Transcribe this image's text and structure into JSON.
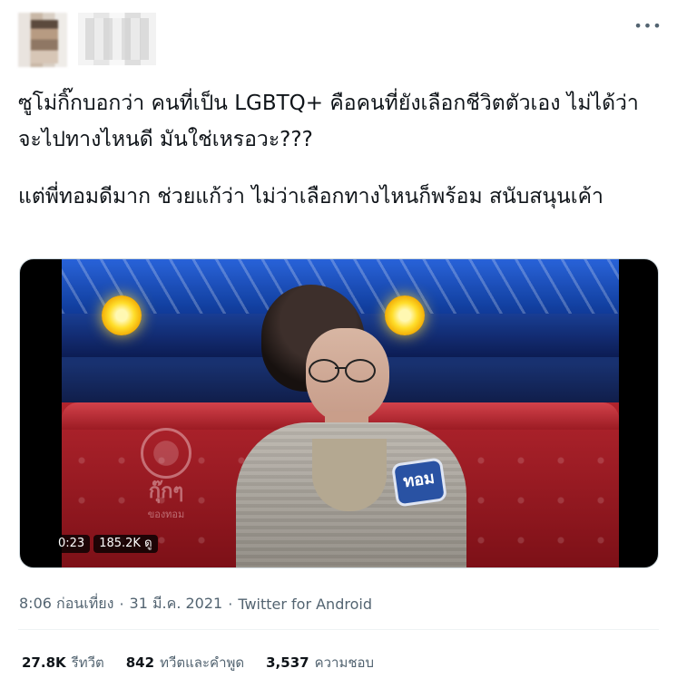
{
  "tweet": {
    "more_icon": "more-horizontal-icon",
    "text": [
      "ซูโม่กิ๊กบอกว่า คนที่เป็น LGBTQ+ คือคนที่ยังเลือกชีวิตตัวเอง ไม่ได้ว่าจะไปทางไหนดี มันใช่เหรอวะ???",
      "แต่พี่ทอมดีมาก ช่วยแก้ว่า ไม่ว่าเลือกทางไหนก็พร้อม สนับสนุนเค้า"
    ],
    "media": {
      "time": "0:23",
      "views": "185.2K ดู",
      "nametag": "ทอม",
      "watermark_top": "กุ๊กๆ",
      "watermark_bottom": "ของทอม"
    },
    "timestamp": "8:06 ก่อนเที่ยง",
    "date": "31 มี.ค. 2021",
    "client": "Twitter for Android",
    "stats": {
      "retweets_value": "27.8K",
      "retweets_label": "รีทวีต",
      "quotes_value": "842",
      "quotes_label": "ทวีตและคำพูด",
      "likes_value": "3,537",
      "likes_label": "ความชอบ"
    }
  },
  "colors": {
    "text": "#0f1419",
    "secondary": "#536471",
    "border": "#eff3f4"
  }
}
